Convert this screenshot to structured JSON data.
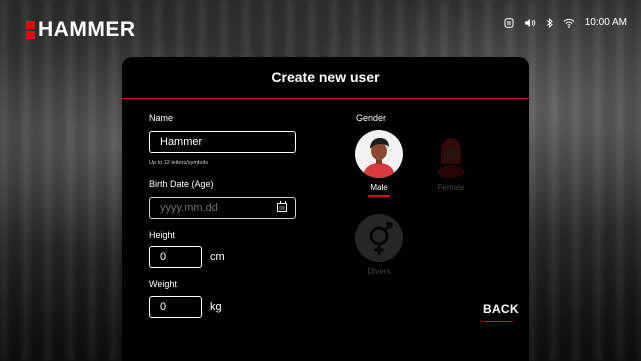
{
  "brand": {
    "name": "HAMMER",
    "accent": "#e30613"
  },
  "status_bar": {
    "time": "10:00 AM",
    "icons": [
      "nfc-icon",
      "volume-icon",
      "bluetooth-icon",
      "wifi-icon"
    ]
  },
  "dialog": {
    "title": "Create new user",
    "name": {
      "label": "Name",
      "value": "Hammer",
      "hint": "Up to 12 letters/symbols"
    },
    "birth_date": {
      "label": "Birth Date (Age)",
      "placeholder": "yyyy.mm.dd"
    },
    "height": {
      "label": "Height",
      "value": "0",
      "unit": "cm"
    },
    "weight": {
      "label": "Weight",
      "value": "0",
      "unit": "kg"
    },
    "gender": {
      "label": "Gender",
      "options": [
        {
          "label": "Male",
          "selected": true
        },
        {
          "label": "Female",
          "selected": false
        },
        {
          "label": "Divers",
          "selected": false
        }
      ]
    },
    "back_label": "BACK"
  }
}
